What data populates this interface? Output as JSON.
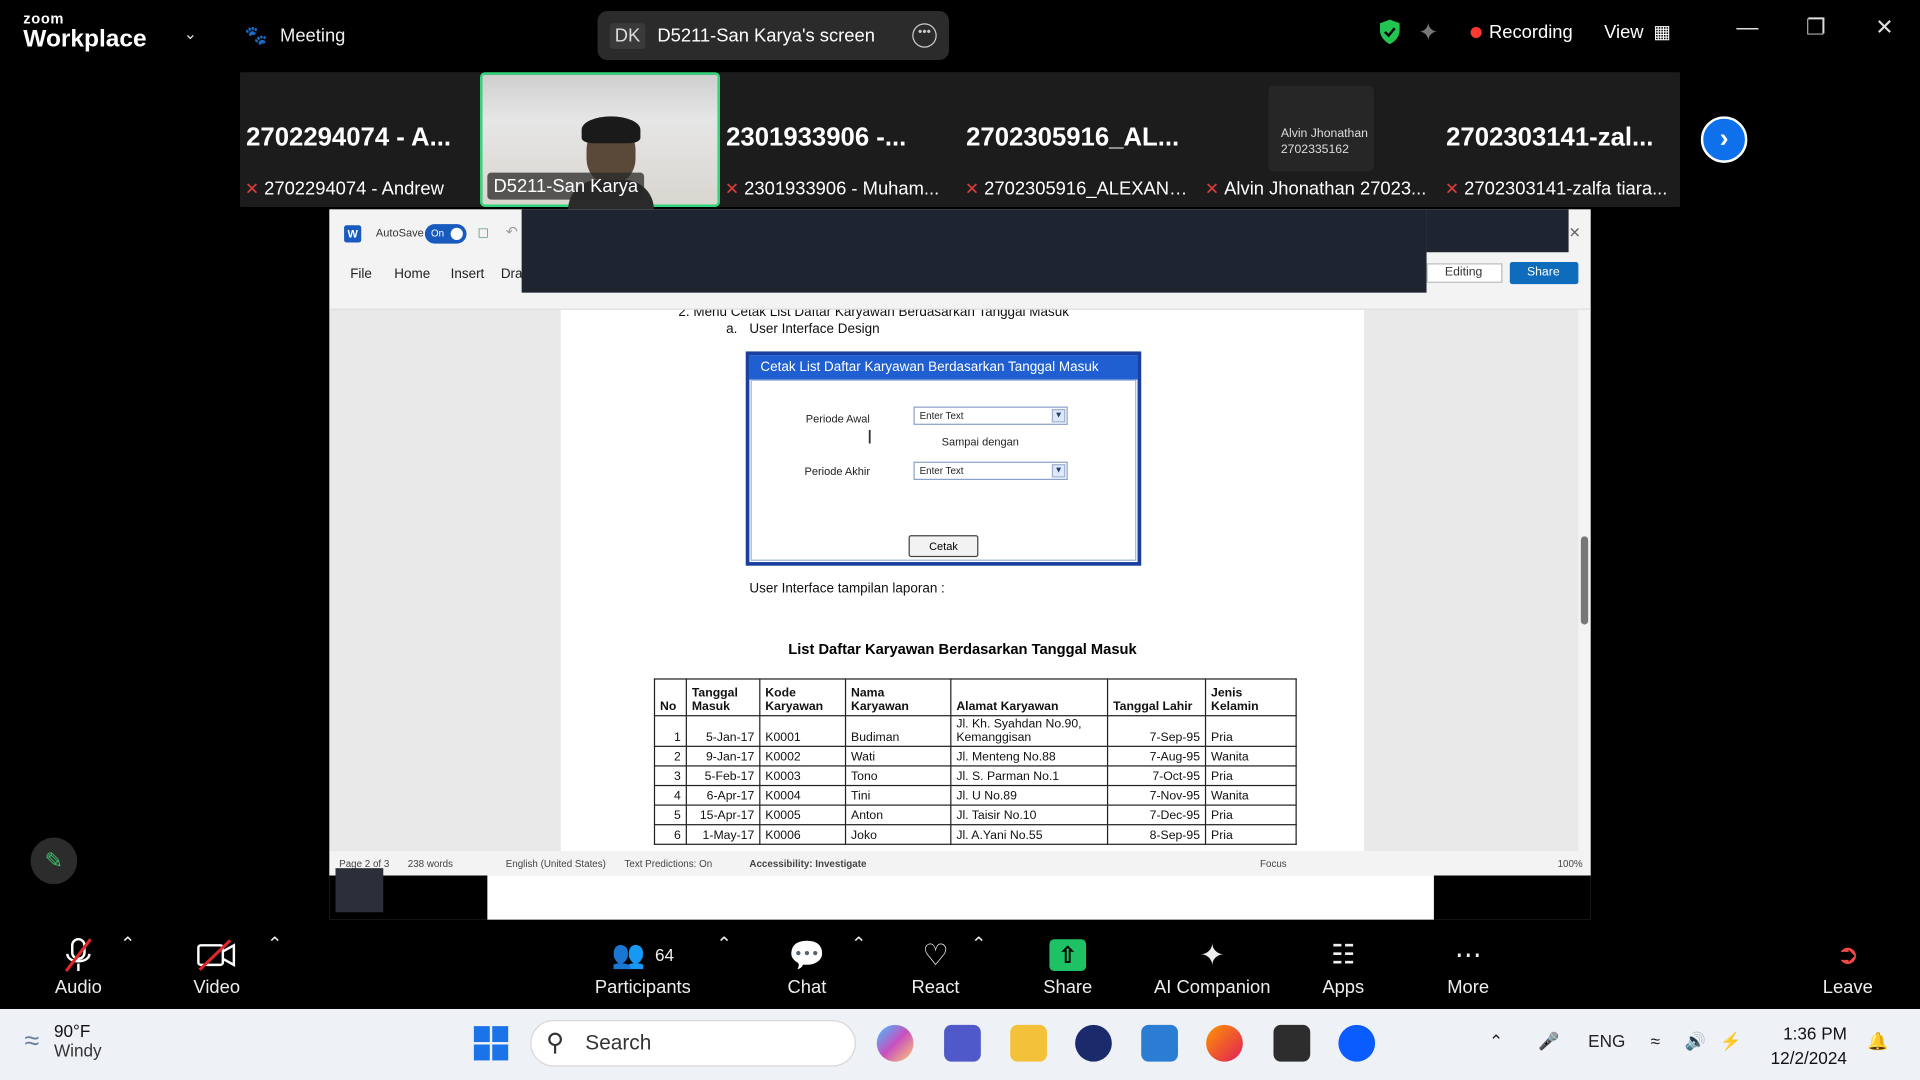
{
  "titlebar": {
    "brand_top": "zoom",
    "brand_bottom": "Workplace",
    "meeting_label": "Meeting",
    "share_initials": "DK",
    "share_title": "D5211-San Karya's screen",
    "recording_label": "Recording",
    "view_label": "View"
  },
  "participants": {
    "tiles": [
      {
        "big": "2702294074  -  A...",
        "label": "2702294074 - Andrew",
        "muted": true
      },
      {
        "big": "",
        "label": "D5211-San Karya",
        "muted": false,
        "video": true
      },
      {
        "big": "2301933906  -...",
        "label": "2301933906 - Muham...",
        "muted": true
      },
      {
        "big": "2702305916_AL...",
        "label": "2702305916_ALEXAND...",
        "muted": true
      },
      {
        "big": "",
        "label": "Alvin Jhonathan 27023...",
        "muted": true,
        "card_name": "Alvin Jhonathan",
        "card_id": "2702335162"
      },
      {
        "big": "2702303141-zal...",
        "label": "2702303141-zalfa tiara...",
        "muted": true
      }
    ]
  },
  "word": {
    "autosave_label": "AutoSave",
    "toggle_label": "On",
    "tabs": [
      "File",
      "Home",
      "Insert",
      "Dra"
    ],
    "editing_label": "Editing",
    "share_label": "Share",
    "doc": {
      "line_top": "2.    Menu Cetak List Daftar Karyawan Berdasarkan Tanggal Masuk",
      "sub_a": "a.",
      "sub_a_text": "User Interface Design",
      "dialog": {
        "title": "Cetak List Daftar Karyawan Berdasarkan Tanggal Masuk",
        "periode_awal": "Periode Awal",
        "periode_akhir": "Periode Akhir",
        "select_placeholder": "Enter Text",
        "sampai": "Sampai dengan",
        "button": "Cetak"
      },
      "ui_laporan": "User Interface tampilan laporan :",
      "report_title": "List Daftar Karyawan Berdasarkan Tanggal Masuk",
      "table": {
        "headers": [
          "No",
          "Tanggal Masuk",
          "Kode Karyawan",
          "Nama Karyawan",
          "Alamat Karyawan",
          "Tanggal Lahir",
          "Jenis Kelamin"
        ],
        "rows": [
          [
            "1",
            "5-Jan-17",
            "K0001",
            "Budiman",
            "Jl. Kh. Syahdan No.90, Kemanggisan",
            "7-Sep-95",
            "Pria"
          ],
          [
            "2",
            "9-Jan-17",
            "K0002",
            "Wati",
            "Jl. Menteng No.88",
            "7-Aug-95",
            "Wanita"
          ],
          [
            "3",
            "5-Feb-17",
            "K0003",
            "Tono",
            "Jl. S. Parman No.1",
            "7-Oct-95",
            "Pria"
          ],
          [
            "4",
            "6-Apr-17",
            "K0004",
            "Tini",
            "Jl. U No.89",
            "7-Nov-95",
            "Wanita"
          ],
          [
            "5",
            "15-Apr-17",
            "K0005",
            "Anton",
            "Jl. Taisir No.10",
            "7-Dec-95",
            "Pria"
          ],
          [
            "6",
            "1-May-17",
            "K0006",
            "Joko",
            "Jl. A.Yani No.55",
            "8-Sep-95",
            "Pria"
          ]
        ]
      }
    },
    "status": {
      "page": "Page 2 of 3",
      "words": "238 words",
      "language": "English (United States)",
      "predictions": "Text Predictions: On",
      "accessibility": "Accessibility: Investigate",
      "focus": "Focus",
      "zoom": "100%"
    }
  },
  "toolbar": {
    "audio": "Audio",
    "video": "Video",
    "participants": "Participants",
    "participants_count": "64",
    "chat": "Chat",
    "react": "React",
    "share": "Share",
    "ai": "AI Companion",
    "apps": "Apps",
    "more": "More",
    "leave": "Leave"
  },
  "taskbar": {
    "temp": "90°F",
    "weather": "Windy",
    "search": "Search",
    "lang": "ENG",
    "time": "1:36 PM",
    "date": "12/2/2024"
  },
  "colors": {
    "zoom_blue": "#0e71eb",
    "active_speaker": "#32d67a",
    "share_green": "#1ec264",
    "recording_red": "#ff3b30",
    "dialog_blue": "#1f5fd1"
  }
}
